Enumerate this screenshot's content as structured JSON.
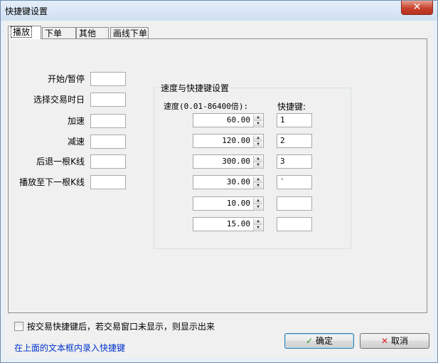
{
  "window": {
    "title": "快捷键设置",
    "close_glyph": "✕"
  },
  "tabs": [
    "播放",
    "下单",
    "其他",
    "画线下单"
  ],
  "left_fields": [
    {
      "label": "开始/暂停",
      "value": ""
    },
    {
      "label": "选择交易时日",
      "value": ""
    },
    {
      "label": "加速",
      "value": ""
    },
    {
      "label": "减速",
      "value": ""
    },
    {
      "label": "后退一根K线",
      "value": ""
    },
    {
      "label": "播放至下一根K线",
      "value": ""
    }
  ],
  "speed_group": {
    "title": "速度与快捷键设置",
    "speed_header": "速度(0.01-86400倍):",
    "key_header": "快捷键:",
    "rows": [
      {
        "speed": "60.00",
        "key": "1"
      },
      {
        "speed": "120.00",
        "key": "2"
      },
      {
        "speed": "300.00",
        "key": "3"
      },
      {
        "speed": "30.00",
        "key": "`"
      },
      {
        "speed": "10.00",
        "key": ""
      },
      {
        "speed": "15.00",
        "key": ""
      }
    ]
  },
  "footer": {
    "checkbox_label": "按交易快捷键后，若交易窗口未显示，则显示出来",
    "checkbox_checked": false,
    "hint": "在上面的文本框内录入快捷键",
    "ok_label": "确定",
    "cancel_label": "取消"
  }
}
